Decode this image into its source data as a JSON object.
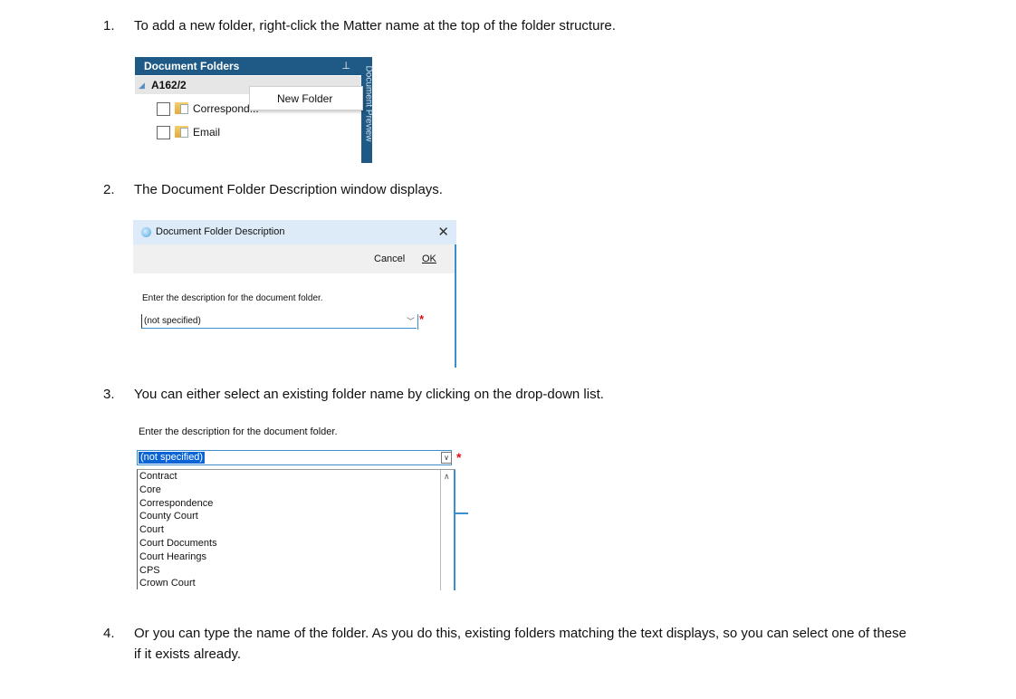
{
  "steps": [
    {
      "number": "1.",
      "text": "To add a new folder, right-click the Matter name at the top of the folder structure."
    },
    {
      "number": "2.",
      "text": "The Document Folder Description window displays."
    },
    {
      "number": "3.",
      "text": "You can either select an existing folder name by clicking on the drop-down list."
    },
    {
      "number": "4.",
      "text": "Or you can type the name of the folder. As you do this, existing folders matching the text displays, so you can select one of these",
      "text2": "if it exists already."
    }
  ],
  "screenshot1": {
    "panel_title": "Document Folders",
    "pin_glyph": "⊥",
    "side_tab": "Document Preview",
    "matter": "A162/2",
    "items": [
      "Correspond...",
      "Email"
    ],
    "context_menu": "New Folder",
    "colors": {
      "header": "#1f5a86"
    }
  },
  "screenshot2": {
    "window_title": "Document Folder Description",
    "close_glyph": "✕",
    "cancel": "Cancel",
    "ok": "OK",
    "prompt": "Enter the description for the document folder.",
    "value": "(not specified)",
    "required_mark": "*"
  },
  "screenshot3": {
    "prompt": "Enter the description for the document folder.",
    "value": "(not specified)",
    "required_mark": "*",
    "options": [
      "Contract",
      "Core",
      "Correspondence",
      "County Court",
      "Court",
      "Court Documents",
      "Court Hearings",
      "CPS",
      "Crown Court"
    ]
  }
}
